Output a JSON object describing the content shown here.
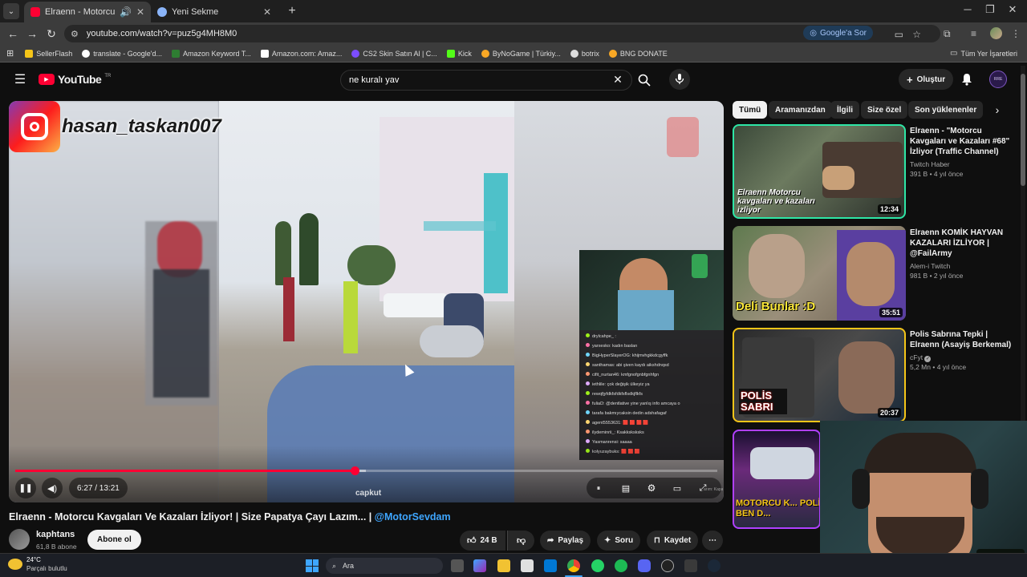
{
  "browser": {
    "tabs": [
      {
        "title": "Elraenn - Motorcu Kavgaları",
        "active": true
      },
      {
        "title": "Yeni Sekme",
        "active": false
      }
    ],
    "new_tab": "+",
    "url": "youtube.com/watch?v=puz5g4MH8M0",
    "google_sor": "Google'a Sor",
    "bookmarks": [
      "SellerFlash",
      "translate - Google'd...",
      "Amazon Keyword T...",
      "Amazon.com: Amaz...",
      "CS2 Skin Satın Al | C...",
      "Kick",
      "ByNoGame | Türkiy...",
      "botrix",
      "BNG DONATE"
    ],
    "all_bookmarks": "Tüm Yer İşaretleri"
  },
  "youtube": {
    "logo": "YouTube",
    "region": "TR",
    "search_query": "ne kuralı yav",
    "create_label": "Oluştur",
    "avatar_badge": "RRE"
  },
  "player": {
    "overlay_handle": "hasan_taskan007",
    "time_current": "6:27",
    "time_total": "13:21",
    "time_display": "6:27 / 13:21",
    "progress_fraction": 0.483,
    "watermark": "capkut",
    "muted_label": "arım: Kapalı"
  },
  "chat_lines": [
    "drylcahpe_ :",
    "yarxesko: kadın basları",
    "BigHyperSlayerOG: khijmvhgkkdcgyffk",
    "santhamas: abi şiven kaydı aikshdnqsd",
    "cifit_nurtan46: kmfgnofgnbfgnhfgn",
    "iethlile: çok değişik ülkeyiz ya",
    "rewqfjyfdkfsfdkfsflsdkjflkfs",
    "fuliaD: @dentlative yine yanlış info amcaya o",
    "tarafa bakmıycaksin dedin adshafagaf",
    "agent5553631: 🟥 🟥 🟥 🟥",
    "ilydeminrii_: Ksakksksksks",
    "Yasmanrensi: saaaa",
    "kolyuzaybuks: 🟥 🟥 🟥"
  ],
  "video": {
    "title": "Elraenn - Motorcu Kavgaları Ve Kazaları İzliyor! | Size Papatya Çayı Lazım... |",
    "title_tag": "@MotorSevdam",
    "channel": "kaphtans",
    "subscribers": "61,8 B abone",
    "subscribe_label": "Abone ol",
    "likes": "24 B",
    "share_label": "Paylaş",
    "ask_label": "Soru",
    "save_label": "Kaydet"
  },
  "chips": [
    "Tümü",
    "Aramanızdan",
    "İlgili",
    "Size özel",
    "Son yüklenenler"
  ],
  "recommendations": [
    {
      "title": "Elraenn - \"Motorcu Kavgaları ve Kazaları #68\" İzliyor (Traffic Channel)",
      "channel": "Twitch Haber",
      "views": "391 B",
      "age": "4 yıl önce",
      "duration": "12:34",
      "overlay": "Elraenn Motorcu kavgaları ve kazaları izliyor",
      "verified": false
    },
    {
      "title": "Elraenn KOMİK HAYVAN KAZALARI İZLİYOR | @FailArmy",
      "channel": "Alem-i Twitch",
      "views": "981 B",
      "age": "2 yıl önce",
      "duration": "35:51",
      "overlay": "Deli Bunlar :D",
      "verified": false
    },
    {
      "title": "Polis Sabrına Tepki | Elraenn (Asayiş Berkemal)",
      "channel": "cFyt",
      "views": "5,2 Mn",
      "age": "4 yıl önce",
      "duration": "20:37",
      "overlay": "POLİS SABRI",
      "verified": true
    },
    {
      "title": "",
      "channel": "",
      "views": "",
      "age": "",
      "duration": "",
      "overlay": "MOTORCU K... POLİSİM BEN D...",
      "verified": false
    }
  ],
  "taskbar": {
    "temperature": "24°C",
    "weather": "Parçalı bulutlu",
    "search_label": "Ara",
    "kick_digit": "7"
  },
  "colors": {
    "progress_red": "#ff0033",
    "link_blue": "#3ea6ff",
    "kick_green": "#53fc18"
  }
}
